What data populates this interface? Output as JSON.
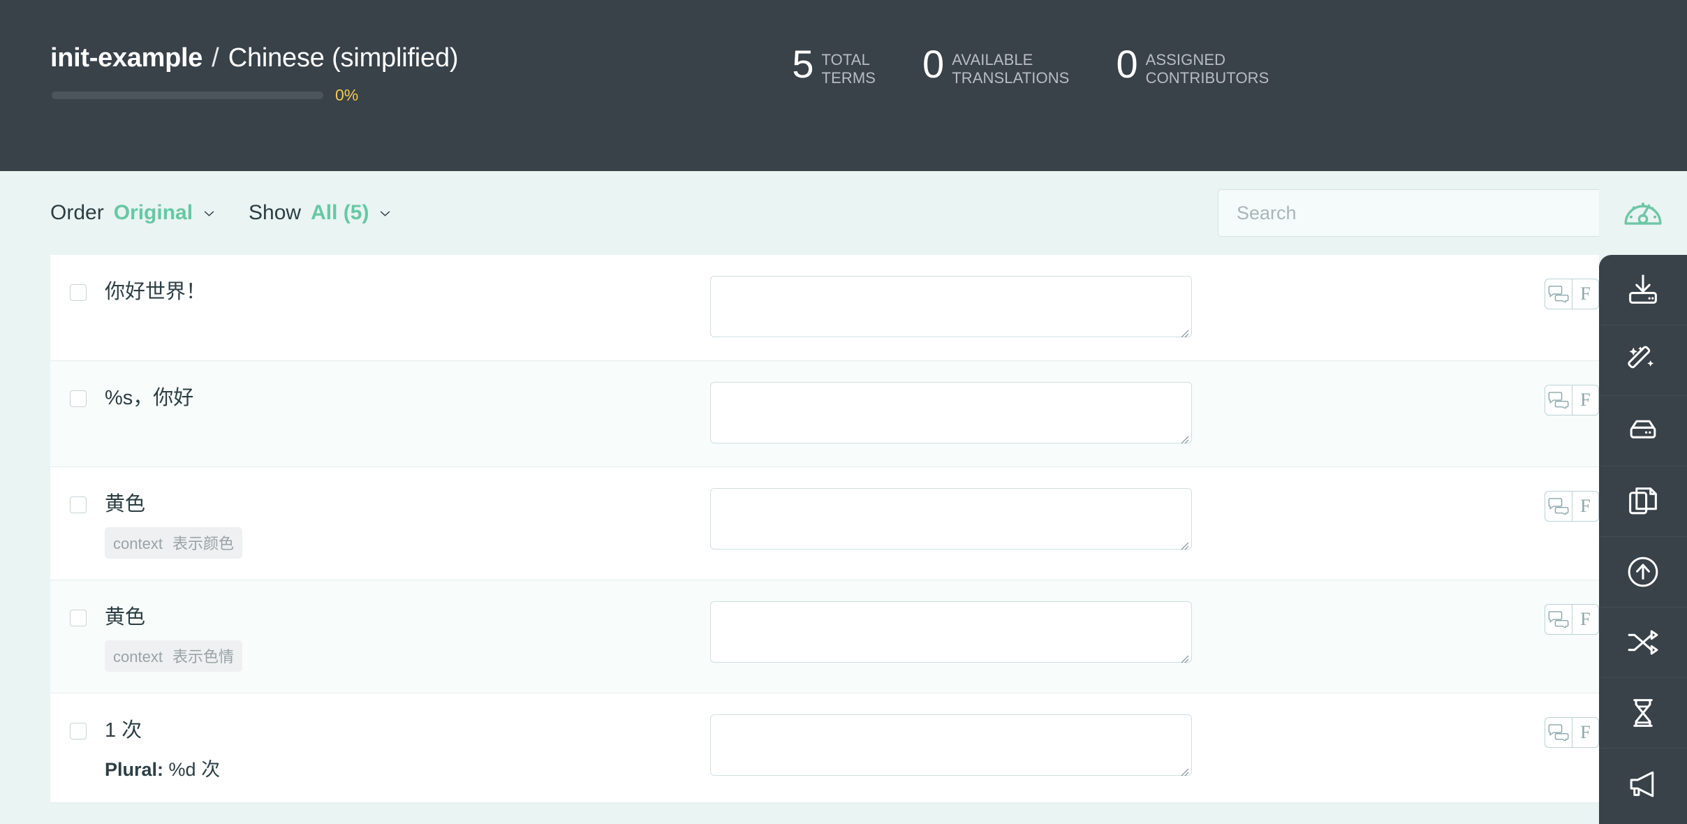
{
  "header": {
    "project_name": "init-example",
    "separator": "/",
    "language": "Chinese (simplified)",
    "progress_percent_label": "0%",
    "progress_percent_value": 0,
    "progress_color": "#f1cd4b",
    "background_color": "#394149",
    "stats": [
      {
        "value": "5",
        "label_line1": "TOTAL",
        "label_line2": "TERMS"
      },
      {
        "value": "0",
        "label_line1": "AVAILABLE",
        "label_line2": "TRANSLATIONS"
      },
      {
        "value": "0",
        "label_line1": "ASSIGNED",
        "label_line2": "CONTRIBUTORS"
      }
    ]
  },
  "toolbar": {
    "order_label": "Order",
    "order_value": "Original",
    "show_label": "Show",
    "show_value": "All (5)",
    "search_placeholder": "Search",
    "search_value": "",
    "accent_color": "#66c8a4",
    "gauge_icon": "gauge-icon"
  },
  "terms": [
    {
      "term": "你好世界！",
      "context_key": "",
      "context_value": "",
      "plural_label": "",
      "plural_value": "",
      "translation": "",
      "comment_icon": "comment-icon",
      "format_label": "F"
    },
    {
      "term": "%s，你好",
      "context_key": "",
      "context_value": "",
      "plural_label": "",
      "plural_value": "",
      "translation": "",
      "comment_icon": "comment-icon",
      "format_label": "F"
    },
    {
      "term": "黄色",
      "context_key": "context",
      "context_value": "表示颜色",
      "plural_label": "",
      "plural_value": "",
      "translation": "",
      "comment_icon": "comment-icon",
      "format_label": "F"
    },
    {
      "term": "黄色",
      "context_key": "context",
      "context_value": "表示色情",
      "plural_label": "",
      "plural_value": "",
      "translation": "",
      "comment_icon": "comment-icon",
      "format_label": "F"
    },
    {
      "term": "1 次",
      "context_key": "",
      "context_value": "",
      "plural_label": "Plural:",
      "plural_value": "%d 次",
      "translation": "",
      "comment_icon": "comment-icon",
      "format_label": "F"
    }
  ],
  "sidebar": {
    "items": [
      {
        "icon": "import-tray-icon"
      },
      {
        "icon": "magic-wand-icon"
      },
      {
        "icon": "archive-drive-icon"
      },
      {
        "icon": "duplicate-pages-icon"
      },
      {
        "icon": "upload-circle-icon"
      },
      {
        "icon": "shuffle-icon"
      },
      {
        "icon": "hourglass-icon"
      },
      {
        "icon": "megaphone-icon"
      }
    ]
  }
}
